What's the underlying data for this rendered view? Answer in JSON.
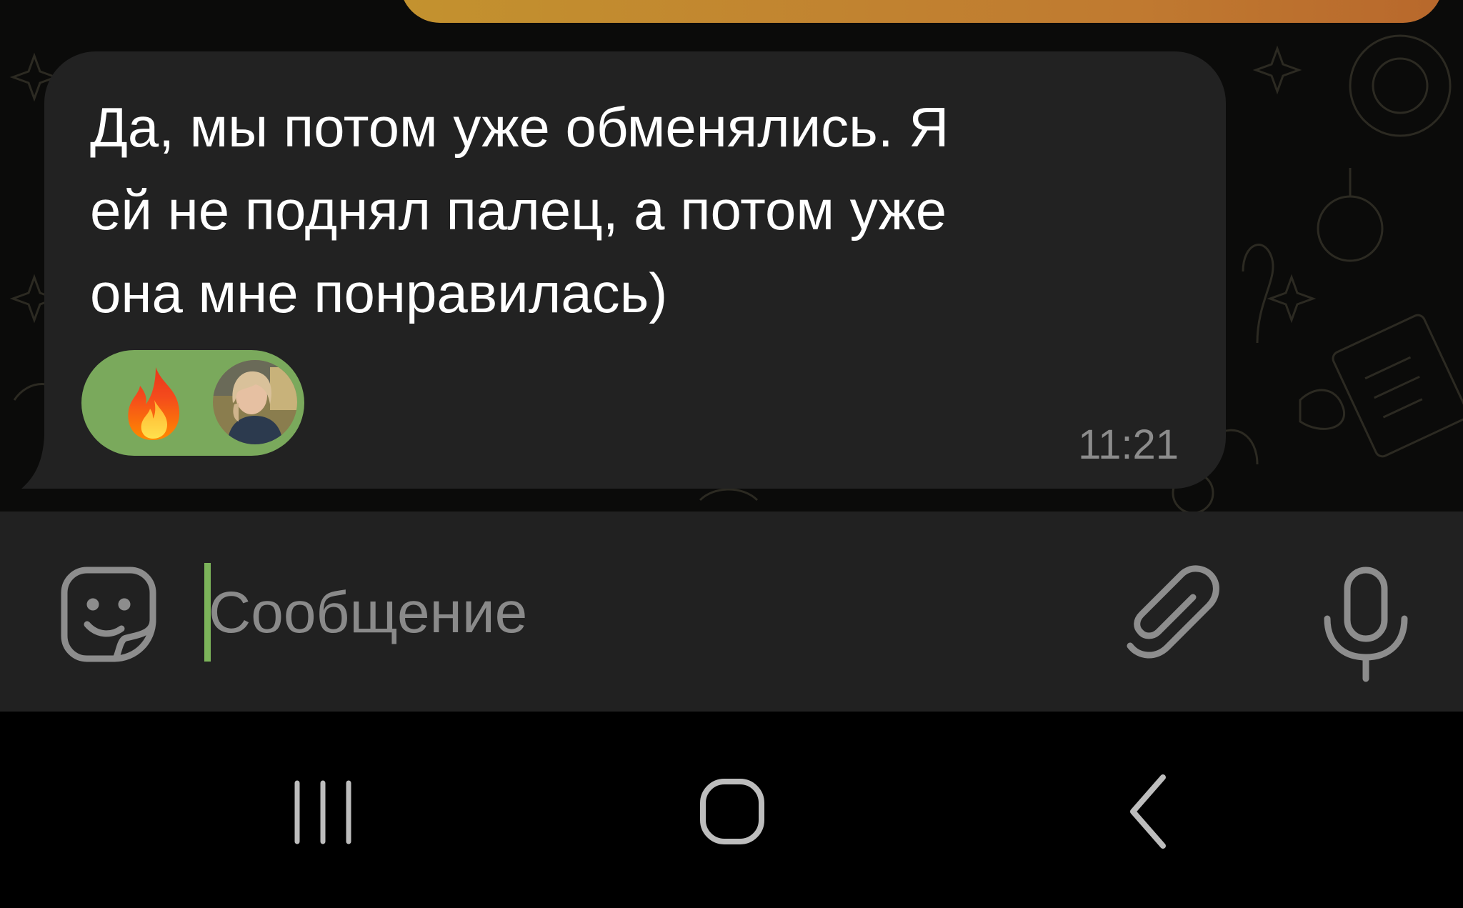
{
  "message": {
    "lines": [
      "Да, мы потом уже обменялись. Я",
      "ей не поднял палец, а потом уже",
      "она мне понравилась)"
    ],
    "time": "11:21",
    "reaction": {
      "emoji_icon": "fire-icon",
      "reactor": "user-avatar",
      "color": "#7aa95c"
    }
  },
  "input": {
    "placeholder": "Сообщение",
    "value": ""
  },
  "icons": {
    "sticker": "sticker-icon",
    "attach": "paperclip-icon",
    "mic": "microphone-icon"
  },
  "nav": {
    "recent": "recent-apps-icon",
    "home": "home-icon",
    "back": "back-icon"
  },
  "colors": {
    "bubble": "#222222",
    "background": "#0b0b0a",
    "accent": "#7cb45a",
    "previous_bubble": "#c3922f"
  }
}
